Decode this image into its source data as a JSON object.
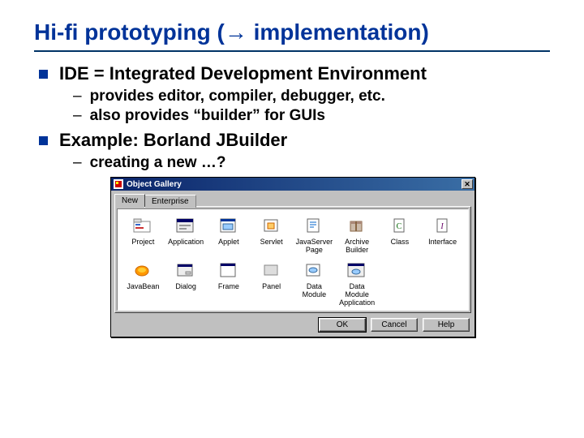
{
  "title": "Hi-fi prototyping (→ implementation)",
  "bullets": {
    "b1": "IDE = Integrated Development Environment",
    "b1a": "provides editor, compiler, debugger, etc.",
    "b1b": "also provides “builder” for GUIs",
    "b2": "Example: Borland JBuilder",
    "b2a": "creating a new …?"
  },
  "dialog": {
    "title": "Object Gallery",
    "tabs": {
      "new": "New",
      "enterprise": "Enterprise"
    },
    "items": {
      "project": "Project",
      "application": "Application",
      "applet": "Applet",
      "servlet": "Servlet",
      "jsp": "JavaServer Page",
      "archive": "Archive Builder",
      "class": "Class",
      "interface": "Interface",
      "javabean": "JavaBean",
      "dialog_item": "Dialog",
      "frame": "Frame",
      "panel": "Panel",
      "datamodule": "Data Module",
      "datamoduleapp": "Data Module Application"
    },
    "buttons": {
      "ok": "OK",
      "cancel": "Cancel",
      "help": "Help"
    }
  }
}
